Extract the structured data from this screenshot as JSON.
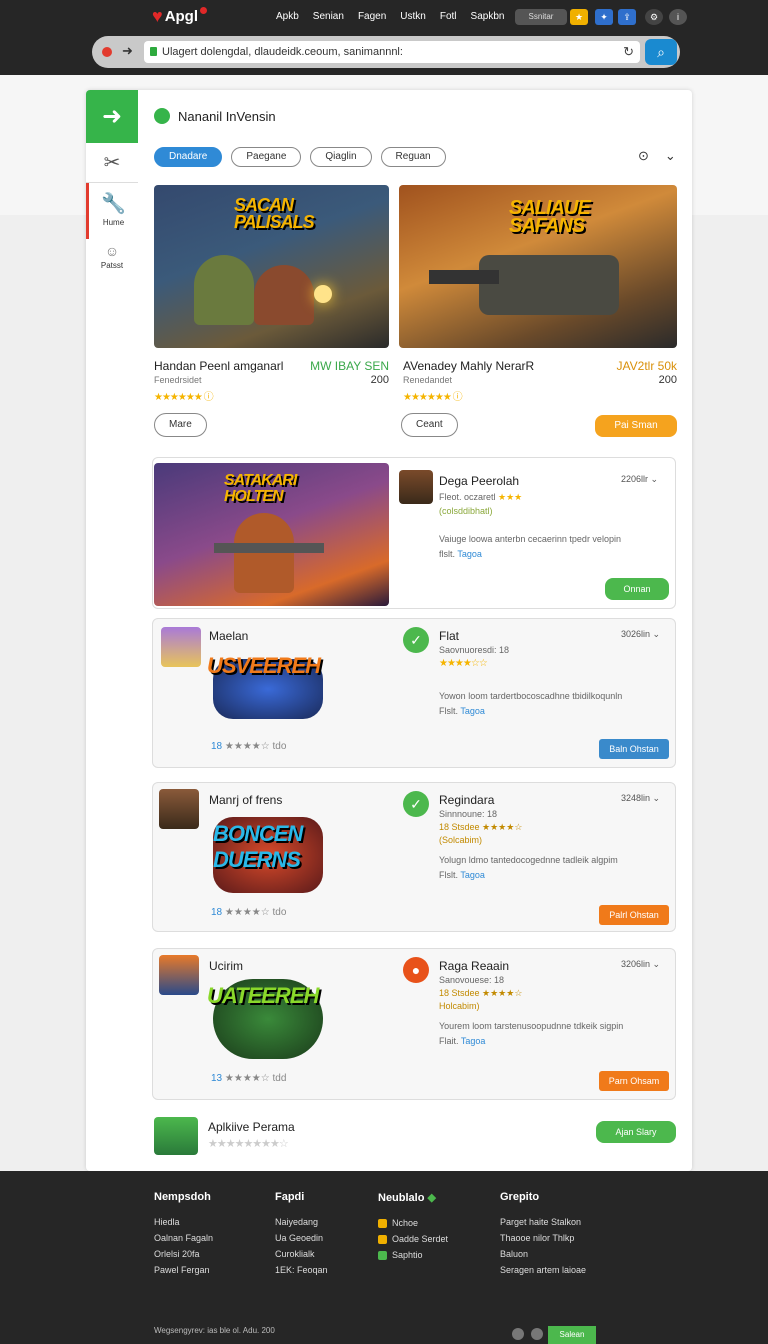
{
  "app": {
    "logo_text": "Apgl"
  },
  "topnav": [
    "Apkb",
    "Senian",
    "Fagen",
    "Ustkn",
    "Fotl",
    "Sapkbn"
  ],
  "top_search": "Ssnitar",
  "browser": {
    "url": "Ulagert dolengdal, dlaudeidk.ceoum, sanimannnl:"
  },
  "sidebar": {
    "home_label": "Hume",
    "profile_label": "Patsst"
  },
  "page": {
    "title": "Nananil InVensin"
  },
  "tabs": [
    "Dnadare",
    "Paegane",
    "Qiaglin",
    "Reguan"
  ],
  "featured": [
    {
      "art_title": "SACAN PALISALS",
      "title": "Handan Peenl amganarl",
      "price": "MW IBAY SEN",
      "sub": "Fenedrsidet",
      "num": "200",
      "button": "Mare"
    },
    {
      "art_title": "SALIAUE SAFANS",
      "title": "AVenadey Mahly NerarR",
      "price": "JAV2tlr 50k",
      "sub": "Renedandet",
      "num": "200",
      "button": "Ceant",
      "cta": "Pai Sman"
    }
  ],
  "hero": {
    "art_title": "SATAKARI HOLTEN",
    "title": "Dega Peerolah",
    "rating_text": "Fleot. oczaretl",
    "sub": "(colsddibhatl)",
    "time": "2206llr",
    "desc": "Vaiuge loowa anterbn cecaerinn tpedr velopin",
    "desc_prefix": "flslt.",
    "desc_link": "Tagoa",
    "button": "Onnan"
  },
  "items": [
    {
      "left_title": "Maelan",
      "art_title": "USVEEREH",
      "title": "Flat",
      "sub": "Saovnuoresdi: 18",
      "time": "3026lin",
      "desc": "Yowon loom tardertbocoscadhne tbidilkoqunln",
      "desc_prefix": "Flslt.",
      "desc_link": "Tagoa",
      "rating": "18",
      "rating_suffix": "tdo",
      "button": "Baln Ohstan"
    },
    {
      "left_title": "Manrj of frens",
      "art_title": "BONCEN DUERNS",
      "title": "Regindara",
      "sub": "Sinnnoune: 18",
      "sub2_prefix": "18 Stsdee",
      "sub2": "(Solcabim)",
      "time": "3248lin",
      "desc": "Yolugn ldmo tantedocogednne tadleik algpim",
      "desc_prefix": "Flslt.",
      "desc_link": "Tagoa",
      "rating": "18",
      "rating_suffix": "tdo",
      "button": "Palrl Ohstan"
    },
    {
      "left_title": "Ucirim",
      "art_title": "UATEEREH",
      "title": "Raga Reaain",
      "sub": "Sanovouese: 18",
      "sub2_prefix": "18 Stsdee",
      "sub2": "Holcabim)",
      "time": "3206lin",
      "desc": "Yourem loom tarstenusoopudnne tdkeik sigpin",
      "desc_prefix": "Flait.",
      "desc_link": "Tagoa",
      "rating": "13",
      "rating_suffix": "tdd",
      "button": "Parn Ohsam"
    }
  ],
  "last_item": {
    "title": "Aplkiive Perama",
    "button": "Ajan Slary"
  },
  "footer": {
    "cols": [
      {
        "title": "Nempsdoh",
        "links": [
          "Hiedla",
          "Oalnan Fagaln",
          "Orlelsi 20fa",
          "Pawel Fergan"
        ]
      },
      {
        "title": "Fapdi",
        "links": [
          "Naiyedang",
          "Ua Geoedin",
          "Curoklialk",
          "1EK: Feoqan"
        ]
      },
      {
        "title": "Neublalo",
        "links": [
          "Nchoe",
          "Oadde Serdet",
          "Saphtio"
        ]
      },
      {
        "title": "Grepito",
        "links": [
          "Parget haite Stalkon",
          "Thaooe nilor Thlkp",
          "Baluon",
          "Seragen artem laioae"
        ]
      }
    ],
    "bottom_text": "Wegsengyrev: ias ble ol. Adu. 200",
    "button": "Salean"
  },
  "colors": {
    "green": "#36b44a",
    "blue": "#2f8ad6",
    "orange": "#f5a31e",
    "dark": "#262626"
  }
}
